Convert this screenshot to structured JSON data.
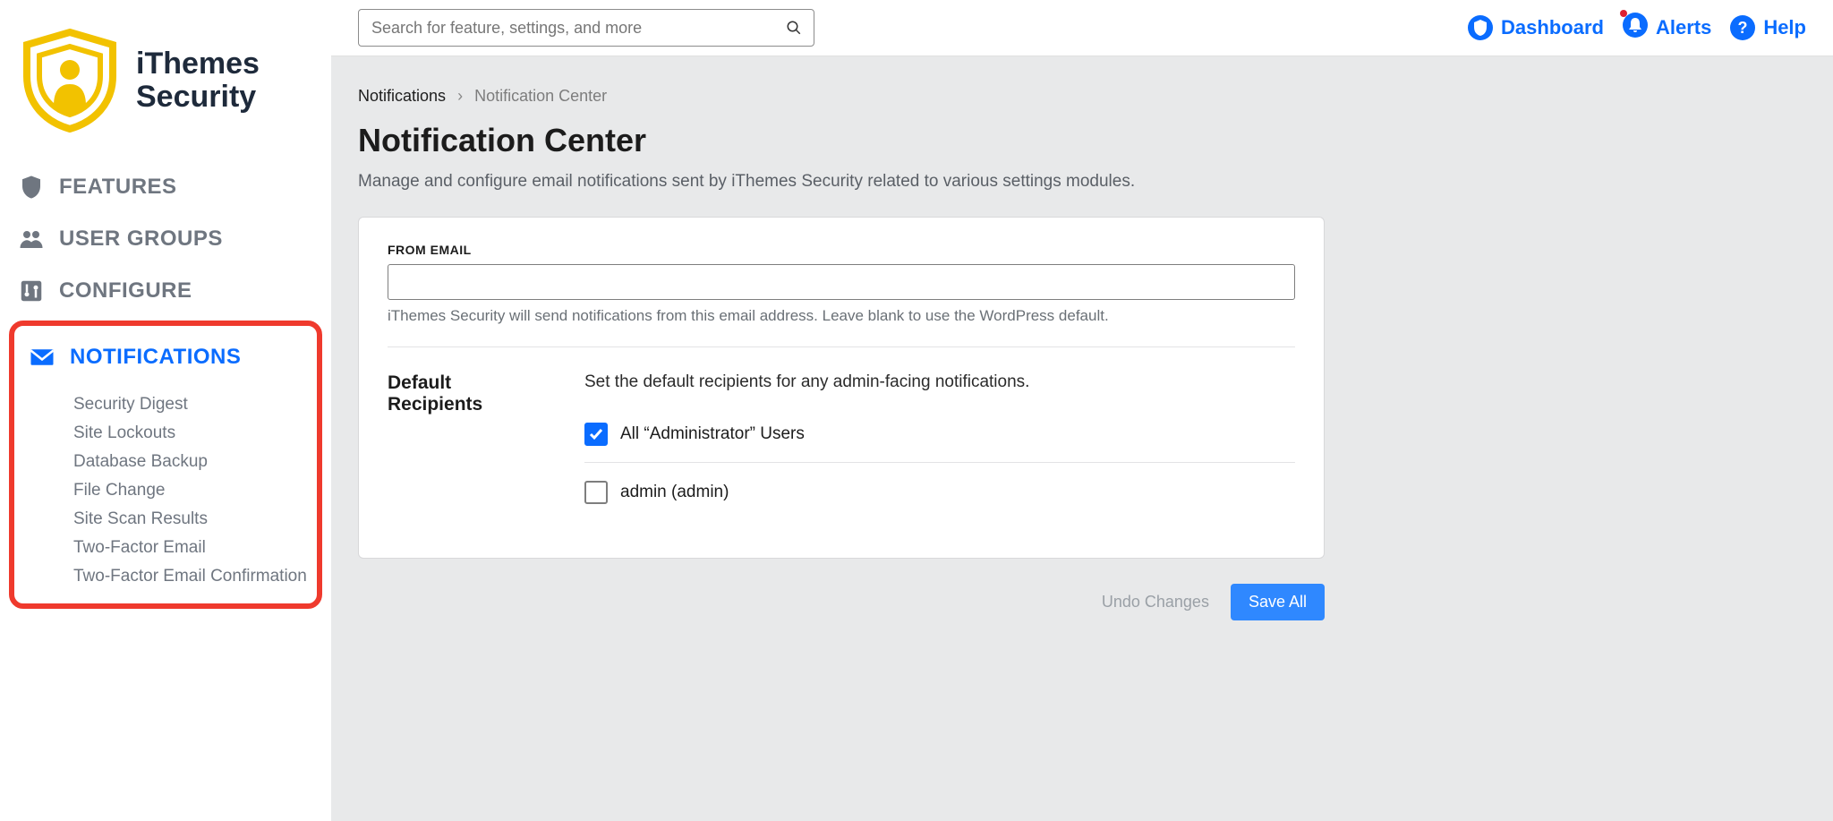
{
  "brand": {
    "line1": "iThemes",
    "line2": "Security"
  },
  "sidebar": {
    "features": "Features",
    "user_groups": "User Groups",
    "configure": "Configure",
    "notifications": "Notifications",
    "sub": [
      "Security Digest",
      "Site Lockouts",
      "Database Backup",
      "File Change",
      "Site Scan Results",
      "Two-Factor Email",
      "Two-Factor Email Confirmation"
    ]
  },
  "topbar": {
    "search_placeholder": "Search for feature, settings, and more",
    "dashboard": "Dashboard",
    "alerts": "Alerts",
    "help": "Help"
  },
  "breadcrumb": {
    "root": "Notifications",
    "current": "Notification Center"
  },
  "page": {
    "title": "Notification Center",
    "desc": "Manage and configure email notifications sent by iThemes Security related to various settings modules."
  },
  "form": {
    "from_email_label": "FROM EMAIL",
    "from_email_value": "",
    "from_email_help": "iThemes Security will send notifications from this email address. Leave blank to use the WordPress default.",
    "recipients_label": "Default Recipients",
    "recipients_desc": "Set the default recipients for any admin-facing notifications.",
    "recipients": [
      {
        "label": "All “Administrator” Users",
        "checked": true
      },
      {
        "label": "admin (admin)",
        "checked": false
      }
    ]
  },
  "actions": {
    "undo": "Undo Changes",
    "save": "Save All"
  }
}
